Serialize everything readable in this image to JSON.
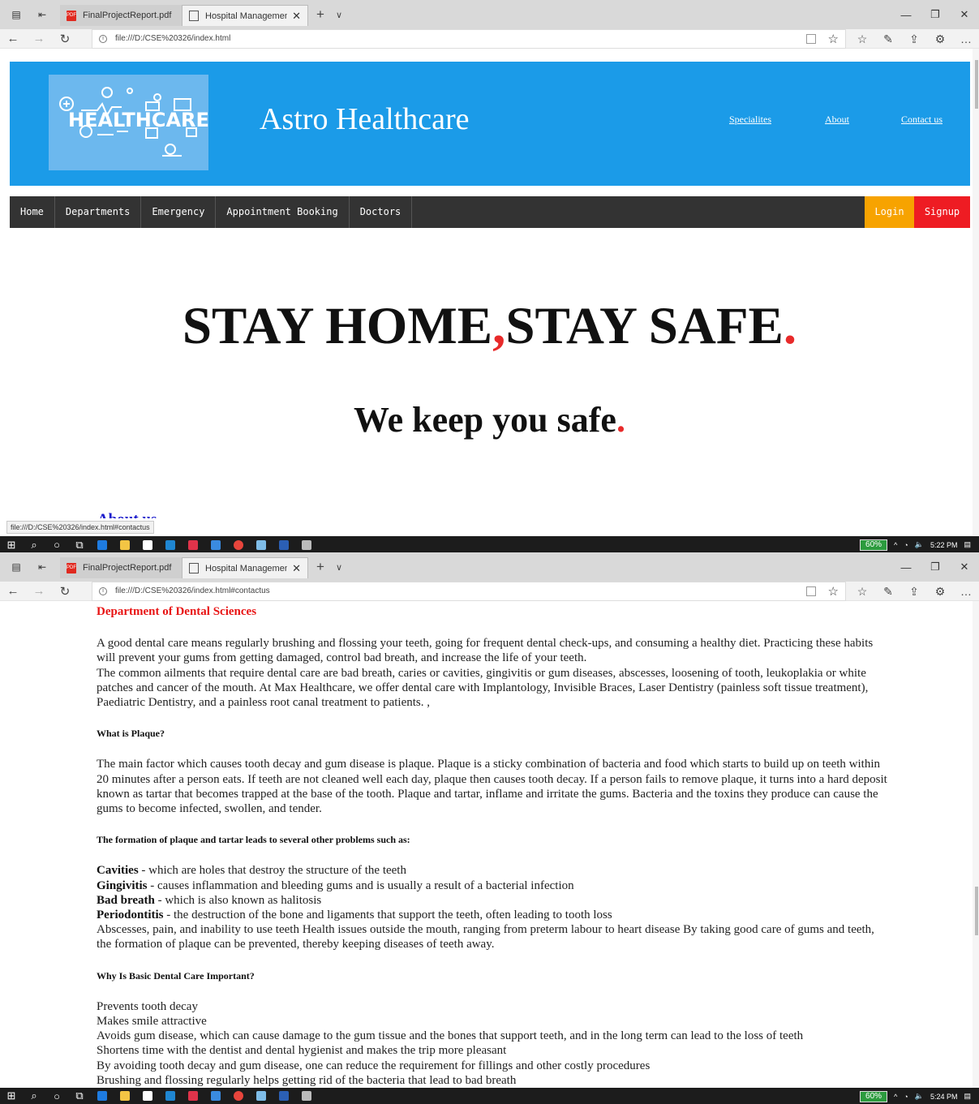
{
  "browser": {
    "tabs": [
      {
        "label": "FinalProjectReport.pdf"
      },
      {
        "label": "Hospital Management S"
      }
    ],
    "url_home": "file:///D:/CSE%20326/index.html",
    "url_contact": "file:///D:/CSE%20326/index.html#contactus",
    "status_link": "file:///D:/CSE%20326/index.html#contactus"
  },
  "header": {
    "logo_text": "HEALTHCARE",
    "site_name": "Astro Healthcare",
    "links": [
      "Specialites",
      "About",
      "Contact us"
    ]
  },
  "menu": {
    "items": [
      "Home",
      "Departments",
      "Emergency",
      "Appointment Booking",
      "Doctors"
    ],
    "login": "Login",
    "signup": "Signup"
  },
  "hero": {
    "line1_a": "STAY HOME",
    "line1_sep": ",",
    "line1_b": "STAY SAFE",
    "line1_dot": ".",
    "line2": "We keep you safe",
    "line2_dot": "."
  },
  "about_heading": "About us",
  "taskbar": {
    "battery1": "60%",
    "time1": "5:22 PM",
    "battery2": "60%",
    "time2": "5:24 PM"
  },
  "dental": {
    "title": "Department of Dental Sciences",
    "intro": [
      "A good dental care means regularly brushing and flossing your teeth, going for frequent dental check-ups, and consuming a healthy diet. Practicing these habits will prevent your gums from getting damaged, control bad breath, and increase the life of your teeth.",
      "The common ailments that require dental care are bad breath, caries or cavities, gingivitis or gum diseases, abscesses, loosening of tooth, leukoplakia or white patches and cancer of the mouth. At Max Healthcare, we offer dental care with Implantology, Invisible Braces, Laser Dentistry (painless soft tissue treatment), Paediatric Dentistry, and a painless root canal treatment to patients. ,"
    ],
    "plaque_heading": "What is Plaque?",
    "plaque_text": "The main factor which causes tooth decay and gum disease is plaque. Plaque is a sticky combination of bacteria and food which starts to build up on teeth within 20 minutes after a person eats. If teeth are not cleaned well each day, plaque then causes tooth decay. If a person fails to remove plaque, it turns into a hard deposit known as tartar that becomes trapped at the base of the tooth. Plaque and tartar, inflame and irritate the gums. Bacteria and the toxins they produce can cause the gums to become infected, swollen, and tender.",
    "problems_heading": "The formation of plaque and tartar leads to several other problems such as:",
    "problems": [
      {
        "term": "Cavities",
        "desc": " - which are holes that destroy the structure of the teeth"
      },
      {
        "term": "Gingivitis",
        "desc": " - causes inflammation and bleeding gums and is usually a result of a bacterial infection"
      },
      {
        "term": "Bad breath",
        "desc": " - which is also known as halitosis"
      },
      {
        "term": "Periodontitis",
        "desc": " - the destruction of the bone and ligaments that support the teeth, often leading to tooth loss"
      }
    ],
    "problems_tail": "Abscesses, pain, and inability to use teeth Health issues outside the mouth, ranging from preterm labour to heart disease By taking good care of gums and teeth, the formation of plaque can be prevented, thereby keeping diseases of teeth away.",
    "why_heading": "Why Is Basic Dental Care Important?",
    "why_items": [
      "Prevents tooth decay",
      "Makes smile attractive",
      "Avoids gum disease, which can cause damage to the gum tissue and the bones that support teeth, and in the long term can lead to the loss of teeth",
      "Shortens time with the dentist and dental hygienist and makes the trip more pleasant",
      "By avoiding tooth decay and gum disease, one can reduce the requirement for fillings and other costly procedures",
      "Brushing and flossing regularly helps getting rid of the bacteria that lead to bad breath"
    ]
  }
}
